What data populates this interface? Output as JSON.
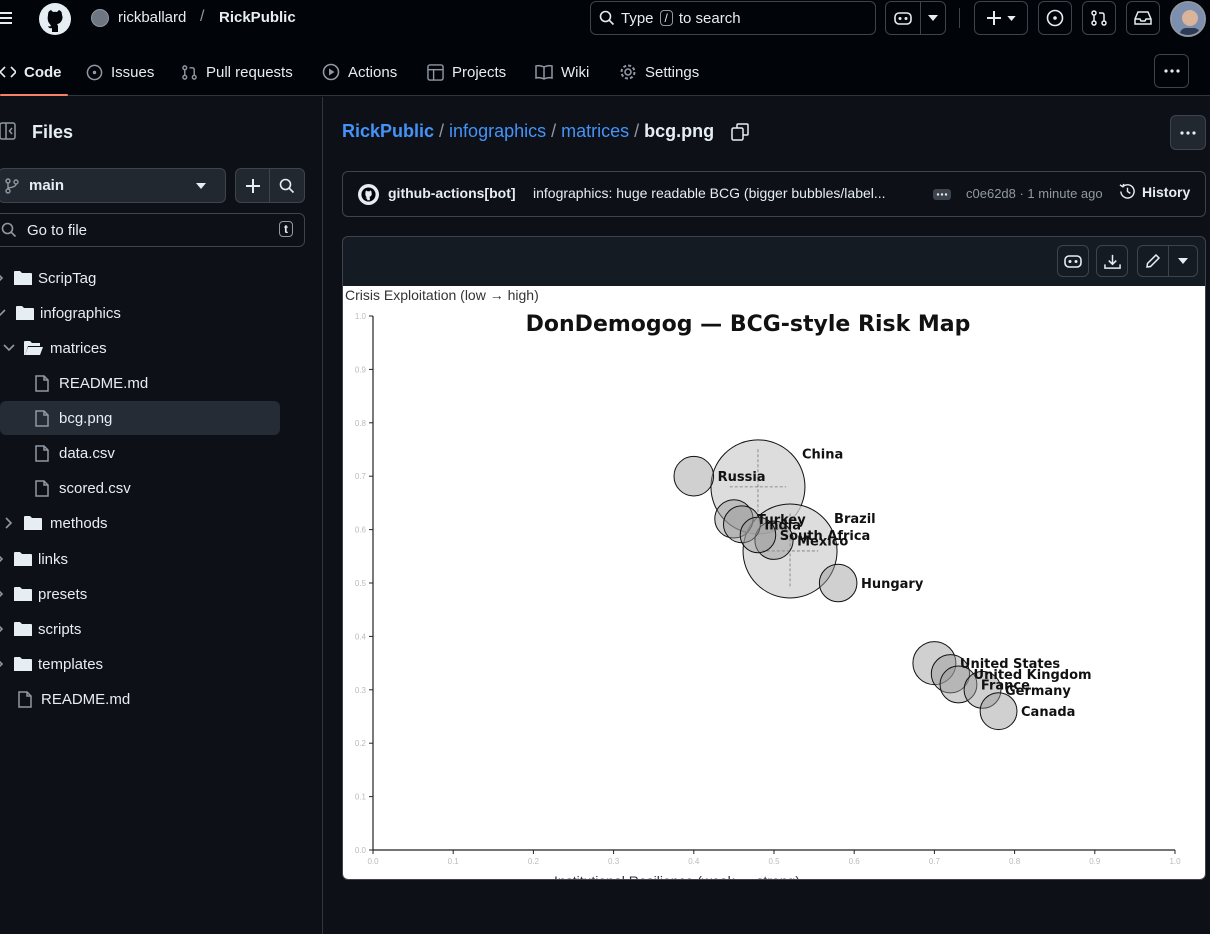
{
  "header": {
    "owner": "rickballard",
    "repo": "RickPublic",
    "search_prefix": "Type",
    "search_key": "/",
    "search_suffix": "to search"
  },
  "nav": {
    "tabs": [
      {
        "label": "Code"
      },
      {
        "label": "Issues"
      },
      {
        "label": "Pull requests"
      },
      {
        "label": "Actions"
      },
      {
        "label": "Projects"
      },
      {
        "label": "Wiki"
      },
      {
        "label": "Settings"
      }
    ]
  },
  "sidebar": {
    "title": "Files",
    "branch": "main",
    "goto_placeholder": "Go to file",
    "goto_shortcut": "t",
    "tree": [
      {
        "label": "ScripTag",
        "kind": "folder"
      },
      {
        "label": "infographics",
        "kind": "folder"
      },
      {
        "label": "matrices",
        "kind": "folder-open"
      },
      {
        "label": "README.md",
        "kind": "file"
      },
      {
        "label": "bcg.png",
        "kind": "file",
        "selected": true
      },
      {
        "label": "data.csv",
        "kind": "file"
      },
      {
        "label": "scored.csv",
        "kind": "file"
      },
      {
        "label": "methods",
        "kind": "folder"
      },
      {
        "label": "links",
        "kind": "folder"
      },
      {
        "label": "presets",
        "kind": "folder"
      },
      {
        "label": "scripts",
        "kind": "folder"
      },
      {
        "label": "templates",
        "kind": "folder"
      },
      {
        "label": "README.md",
        "kind": "file"
      }
    ]
  },
  "breadcrumb": {
    "parts": [
      "RickPublic",
      "infographics",
      "matrices"
    ],
    "file": "bcg.png",
    "sep": "/"
  },
  "commit": {
    "author": "github-actions[bot]",
    "message": "infographics: huge readable BCG (bigger bubbles/label...",
    "meta": "c0e62d8 · 1 minute ago",
    "history_label": "History"
  },
  "chart_data": {
    "type": "scatter",
    "title": "DonDemogog — BCG-style Risk Map",
    "xlabel": "Institutional Resilience (weak → strong)",
    "ylabel": "Crisis Exploitation (low → high)",
    "xlim": [
      0,
      1
    ],
    "ylim": [
      0,
      1
    ],
    "x_ticks": [
      "0.0",
      "0.1",
      "0.2",
      "0.3",
      "0.4",
      "0.5",
      "0.6",
      "0.7",
      "0.8",
      "0.9",
      "1.0"
    ],
    "y_ticks": [
      "0.0",
      "0.1",
      "0.2",
      "0.3",
      "0.4",
      "0.5",
      "0.6",
      "0.7",
      "0.8",
      "0.9",
      "1.0"
    ],
    "points": [
      {
        "label": "Russia",
        "x": 0.4,
        "y": 0.7,
        "size": 0.2
      },
      {
        "label": "China",
        "x": 0.48,
        "y": 0.68,
        "size": 1.0
      },
      {
        "label": "Turkey",
        "x": 0.45,
        "y": 0.62,
        "size": 0.18
      },
      {
        "label": "India",
        "x": 0.46,
        "y": 0.61,
        "size": 0.16
      },
      {
        "label": "South Africa",
        "x": 0.48,
        "y": 0.59,
        "size": 0.14
      },
      {
        "label": "Mexico",
        "x": 0.5,
        "y": 0.58,
        "size": 0.18
      },
      {
        "label": "Brazil",
        "x": 0.52,
        "y": 0.56,
        "size": 1.0
      },
      {
        "label": "Hungary",
        "x": 0.58,
        "y": 0.5,
        "size": 0.17
      },
      {
        "label": "United States",
        "x": 0.7,
        "y": 0.35,
        "size": 0.25
      },
      {
        "label": "United Kingdom",
        "x": 0.72,
        "y": 0.33,
        "size": 0.18
      },
      {
        "label": "France",
        "x": 0.73,
        "y": 0.31,
        "size": 0.16
      },
      {
        "label": "Germany",
        "x": 0.76,
        "y": 0.3,
        "size": 0.16
      },
      {
        "label": "Canada",
        "x": 0.78,
        "y": 0.26,
        "size": 0.16
      }
    ]
  }
}
